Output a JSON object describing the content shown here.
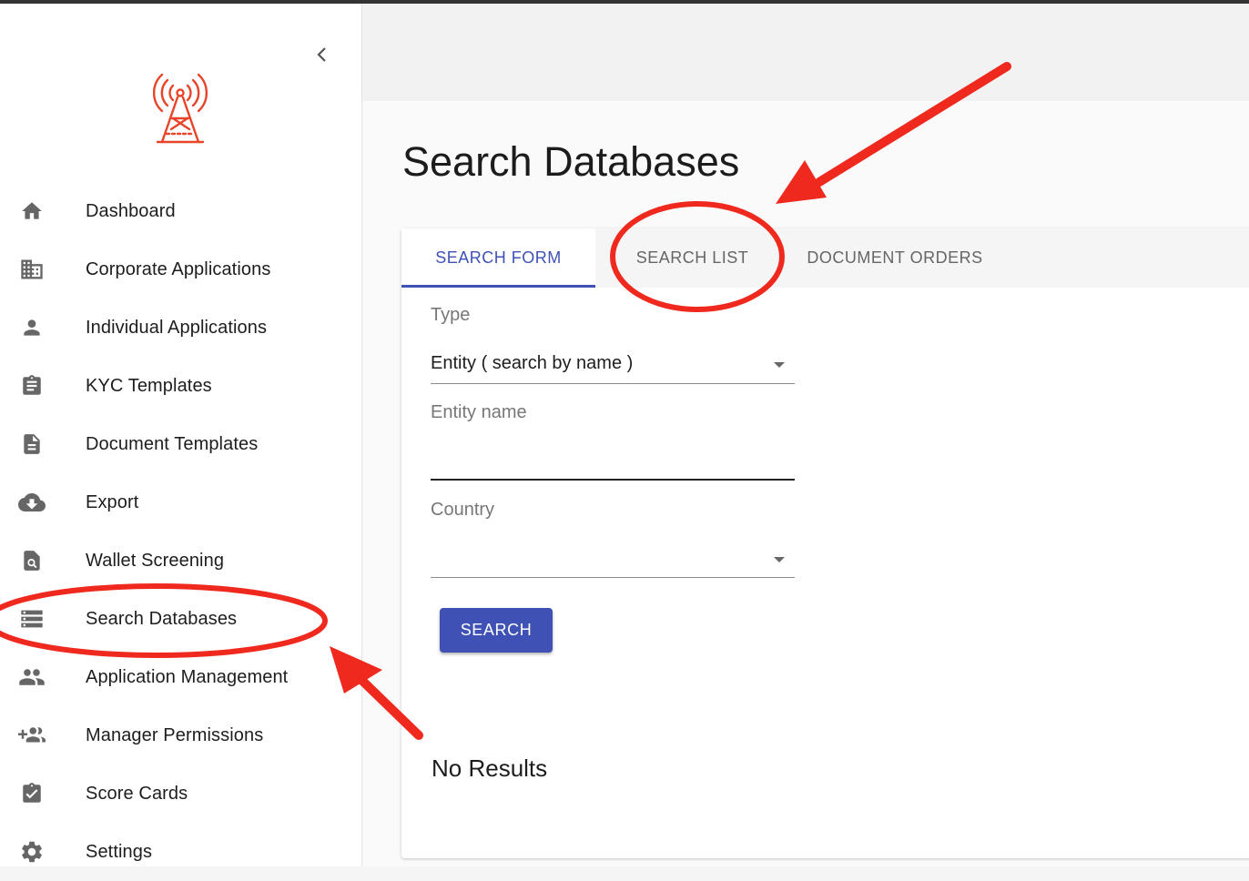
{
  "sidebar": {
    "items": [
      {
        "label": "Dashboard",
        "icon": "home-icon"
      },
      {
        "label": "Corporate Applications",
        "icon": "building-icon"
      },
      {
        "label": "Individual Applications",
        "icon": "person-icon"
      },
      {
        "label": "KYC Templates",
        "icon": "clipboard-icon"
      },
      {
        "label": "Document Templates",
        "icon": "document-icon"
      },
      {
        "label": "Export",
        "icon": "cloud-download-icon"
      },
      {
        "label": "Wallet Screening",
        "icon": "file-search-icon"
      },
      {
        "label": "Search Databases",
        "icon": "storage-icon"
      },
      {
        "label": "Application Management",
        "icon": "people-icon"
      },
      {
        "label": "Manager Permissions",
        "icon": "group-add-icon"
      },
      {
        "label": "Score Cards",
        "icon": "clipboard-check-icon"
      },
      {
        "label": "Settings",
        "icon": "gear-icon"
      }
    ]
  },
  "page": {
    "title": "Search Databases"
  },
  "tabs": [
    {
      "label": "SEARCH FORM",
      "active": true
    },
    {
      "label": "SEARCH LIST",
      "active": false
    },
    {
      "label": "DOCUMENT ORDERS",
      "active": false
    }
  ],
  "form": {
    "type_label": "Type",
    "type_value": "Entity ( search by name )",
    "entity_label": "Entity name",
    "entity_value": "",
    "country_label": "Country",
    "country_value": "",
    "search_button": "SEARCH"
  },
  "results": {
    "empty_text": "No Results"
  },
  "colors": {
    "accent": "#3f51b5",
    "logo": "#e8442a",
    "annotation": "#f0291f"
  }
}
